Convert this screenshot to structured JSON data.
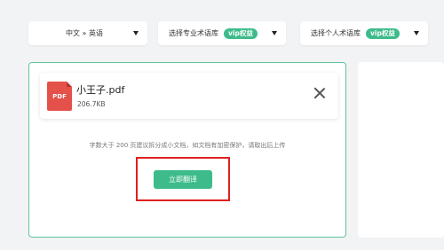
{
  "toolbar": {
    "language_pair": "中文 » 英语",
    "pro_glossary": {
      "label": "选择专业术语库",
      "badge": "vip权益"
    },
    "personal_glossary": {
      "label": "选择个人术语库",
      "badge": "vip权益"
    }
  },
  "file": {
    "icon_text": "PDF",
    "name": "小王子.pdf",
    "size": "206.7KB"
  },
  "hint": "字数大于 200 页建议拆分成小文档，如文档有加密保护，请取出后上传",
  "actions": {
    "translate_label": "立即翻译"
  },
  "colors": {
    "accent": "#3dbb8a",
    "pdf": "#e4504a",
    "highlight": "#e02020"
  }
}
